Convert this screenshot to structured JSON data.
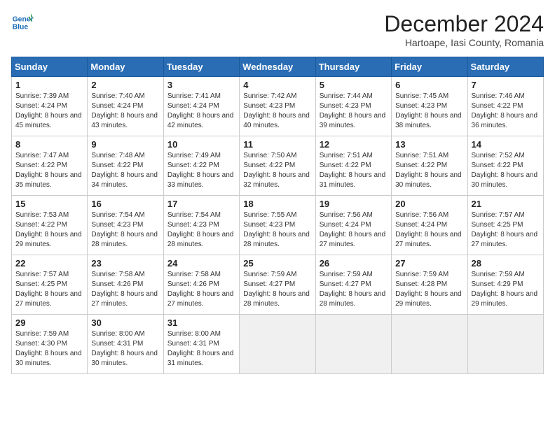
{
  "header": {
    "logo_line1": "General",
    "logo_line2": "Blue",
    "month": "December 2024",
    "location": "Hartoape, Iasi County, Romania"
  },
  "weekdays": [
    "Sunday",
    "Monday",
    "Tuesday",
    "Wednesday",
    "Thursday",
    "Friday",
    "Saturday"
  ],
  "weeks": [
    [
      {
        "day": 1,
        "rise": "7:39 AM",
        "set": "4:24 PM",
        "hours": "8 hours and 45 minutes."
      },
      {
        "day": 2,
        "rise": "7:40 AM",
        "set": "4:24 PM",
        "hours": "8 hours and 43 minutes."
      },
      {
        "day": 3,
        "rise": "7:41 AM",
        "set": "4:24 PM",
        "hours": "8 hours and 42 minutes."
      },
      {
        "day": 4,
        "rise": "7:42 AM",
        "set": "4:23 PM",
        "hours": "8 hours and 40 minutes."
      },
      {
        "day": 5,
        "rise": "7:44 AM",
        "set": "4:23 PM",
        "hours": "8 hours and 39 minutes."
      },
      {
        "day": 6,
        "rise": "7:45 AM",
        "set": "4:23 PM",
        "hours": "8 hours and 38 minutes."
      },
      {
        "day": 7,
        "rise": "7:46 AM",
        "set": "4:22 PM",
        "hours": "8 hours and 36 minutes."
      }
    ],
    [
      {
        "day": 8,
        "rise": "7:47 AM",
        "set": "4:22 PM",
        "hours": "8 hours and 35 minutes."
      },
      {
        "day": 9,
        "rise": "7:48 AM",
        "set": "4:22 PM",
        "hours": "8 hours and 34 minutes."
      },
      {
        "day": 10,
        "rise": "7:49 AM",
        "set": "4:22 PM",
        "hours": "8 hours and 33 minutes."
      },
      {
        "day": 11,
        "rise": "7:50 AM",
        "set": "4:22 PM",
        "hours": "8 hours and 32 minutes."
      },
      {
        "day": 12,
        "rise": "7:51 AM",
        "set": "4:22 PM",
        "hours": "8 hours and 31 minutes."
      },
      {
        "day": 13,
        "rise": "7:51 AM",
        "set": "4:22 PM",
        "hours": "8 hours and 30 minutes."
      },
      {
        "day": 14,
        "rise": "7:52 AM",
        "set": "4:22 PM",
        "hours": "8 hours and 30 minutes."
      }
    ],
    [
      {
        "day": 15,
        "rise": "7:53 AM",
        "set": "4:22 PM",
        "hours": "8 hours and 29 minutes."
      },
      {
        "day": 16,
        "rise": "7:54 AM",
        "set": "4:23 PM",
        "hours": "8 hours and 28 minutes."
      },
      {
        "day": 17,
        "rise": "7:54 AM",
        "set": "4:23 PM",
        "hours": "8 hours and 28 minutes."
      },
      {
        "day": 18,
        "rise": "7:55 AM",
        "set": "4:23 PM",
        "hours": "8 hours and 28 minutes."
      },
      {
        "day": 19,
        "rise": "7:56 AM",
        "set": "4:24 PM",
        "hours": "8 hours and 27 minutes."
      },
      {
        "day": 20,
        "rise": "7:56 AM",
        "set": "4:24 PM",
        "hours": "8 hours and 27 minutes."
      },
      {
        "day": 21,
        "rise": "7:57 AM",
        "set": "4:25 PM",
        "hours": "8 hours and 27 minutes."
      }
    ],
    [
      {
        "day": 22,
        "rise": "7:57 AM",
        "set": "4:25 PM",
        "hours": "8 hours and 27 minutes."
      },
      {
        "day": 23,
        "rise": "7:58 AM",
        "set": "4:26 PM",
        "hours": "8 hours and 27 minutes."
      },
      {
        "day": 24,
        "rise": "7:58 AM",
        "set": "4:26 PM",
        "hours": "8 hours and 27 minutes."
      },
      {
        "day": 25,
        "rise": "7:59 AM",
        "set": "4:27 PM",
        "hours": "8 hours and 28 minutes."
      },
      {
        "day": 26,
        "rise": "7:59 AM",
        "set": "4:27 PM",
        "hours": "8 hours and 28 minutes."
      },
      {
        "day": 27,
        "rise": "7:59 AM",
        "set": "4:28 PM",
        "hours": "8 hours and 29 minutes."
      },
      {
        "day": 28,
        "rise": "7:59 AM",
        "set": "4:29 PM",
        "hours": "8 hours and 29 minutes."
      }
    ],
    [
      {
        "day": 29,
        "rise": "7:59 AM",
        "set": "4:30 PM",
        "hours": "8 hours and 30 minutes."
      },
      {
        "day": 30,
        "rise": "8:00 AM",
        "set": "4:31 PM",
        "hours": "8 hours and 30 minutes."
      },
      {
        "day": 31,
        "rise": "8:00 AM",
        "set": "4:31 PM",
        "hours": "8 hours and 31 minutes."
      },
      null,
      null,
      null,
      null
    ]
  ]
}
